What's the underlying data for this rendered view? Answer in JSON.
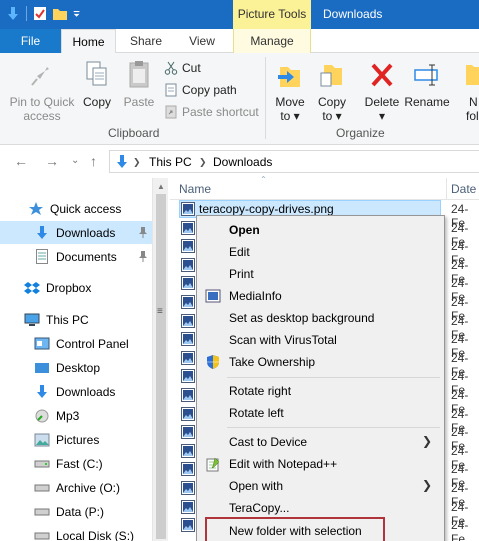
{
  "window": {
    "title": "Downloads",
    "context_tab_group": "Picture Tools"
  },
  "tabs": [
    "File",
    "Home",
    "Share",
    "View",
    "Manage"
  ],
  "ribbon": {
    "clipboard": {
      "pin_to_quick_access": [
        "Pin to Quick",
        "access"
      ],
      "copy": "Copy",
      "paste": "Paste",
      "cut": "Cut",
      "copy_path": "Copy path",
      "paste_shortcut": "Paste shortcut",
      "group_label": "Clipboard"
    },
    "organize": {
      "move_to": [
        "Move",
        "to ▾"
      ],
      "copy_to": [
        "Copy",
        "to ▾"
      ],
      "delete": [
        "Delete",
        "▾"
      ],
      "rename": "Rename",
      "new_folder": [
        "N",
        "fol"
      ],
      "group_label": "Organize"
    }
  },
  "address": {
    "crumbs": [
      "This PC",
      "Downloads"
    ]
  },
  "nav": {
    "items": [
      {
        "label": "Quick access",
        "icon": "star-icon"
      },
      {
        "label": "Downloads",
        "icon": "download-arrow-icon",
        "pinned": true
      },
      {
        "label": "Documents",
        "icon": "document-icon",
        "pinned": true
      },
      {
        "label": "Dropbox",
        "icon": "dropbox-icon"
      },
      {
        "label": "This PC",
        "icon": "computer-icon"
      },
      {
        "label": "Control Panel",
        "icon": "control-panel-icon"
      },
      {
        "label": "Desktop",
        "icon": "desktop-icon"
      },
      {
        "label": "Downloads",
        "icon": "download-arrow-icon"
      },
      {
        "label": "Mp3",
        "icon": "music-folder-icon"
      },
      {
        "label": "Pictures",
        "icon": "pictures-icon"
      },
      {
        "label": "Fast (C:)",
        "icon": "drive-icon"
      },
      {
        "label": "Archive (O:)",
        "icon": "drive-icon"
      },
      {
        "label": "Data (P:)",
        "icon": "drive-icon"
      },
      {
        "label": "Local Disk (S:)",
        "icon": "drive-icon"
      }
    ]
  },
  "filelist": {
    "columns": {
      "name": "Name",
      "date": "Date"
    },
    "selected_name": "teracopy-copy-drives.png",
    "date_text": "24-Fe"
  },
  "context_menu": {
    "items": [
      {
        "label": "Open",
        "bold": true
      },
      {
        "label": "Edit"
      },
      {
        "label": "Print"
      },
      {
        "label": "MediaInfo",
        "icon": "mediainfo-icon"
      },
      {
        "label": "Set as desktop background"
      },
      {
        "label": "Scan with VirusTotal"
      },
      {
        "label": "Take Ownership",
        "icon": "uac-shield-icon"
      },
      {
        "label": "Rotate right"
      },
      {
        "label": "Rotate left"
      },
      {
        "label": "Cast to Device",
        "submenu": true
      },
      {
        "label": "Edit with Notepad++",
        "icon": "notepadpp-icon"
      },
      {
        "label": "Open with",
        "submenu": true
      },
      {
        "label": "TeraCopy..."
      },
      {
        "label": "New folder with selection",
        "highlighted": true
      }
    ]
  }
}
